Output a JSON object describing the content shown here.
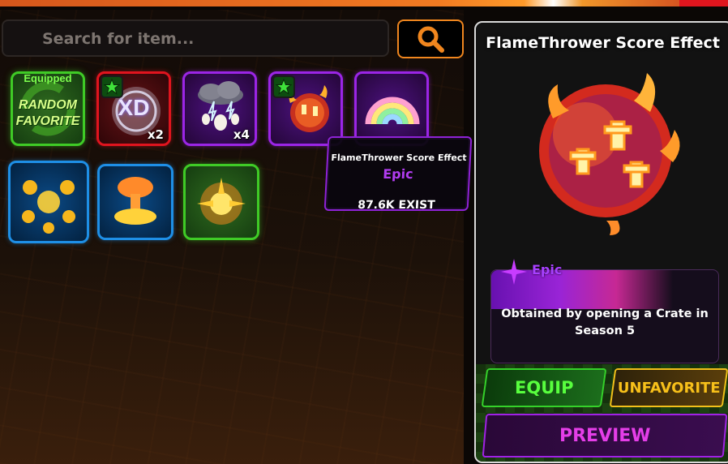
{
  "search": {
    "placeholder": "Search for item..."
  },
  "icons": {
    "search": "search-icon",
    "favorite": "star-icon"
  },
  "inventory": {
    "items": [
      {
        "kind": "random-favorite",
        "line1": "Equipped",
        "line2": "RANDOM",
        "line3": "FAVORITE",
        "border": "green"
      },
      {
        "kind": "xd-effect",
        "label": "XD",
        "quantity": "x2",
        "favorited": true,
        "border": "red"
      },
      {
        "kind": "storm-eggs",
        "quantity": "x4",
        "border": "purple"
      },
      {
        "kind": "flamethrower-score-effect",
        "favorited": true,
        "border": "purple"
      },
      {
        "kind": "rainbow-effect",
        "border": "purple"
      },
      {
        "kind": "coin-burst",
        "border": "blue"
      },
      {
        "kind": "mushroom-explosion",
        "border": "blue"
      },
      {
        "kind": "fire-burst",
        "border": "green"
      }
    ]
  },
  "tooltip": {
    "name": "FlameThrower Score Effect",
    "rarity": "Epic",
    "count": "87.6K EXIST"
  },
  "detail": {
    "title": "FlameThrower Score Effect",
    "rarity": "Epic",
    "description": "Obtained by opening a Crate in Season 5"
  },
  "buttons": {
    "equip": "EQUIP",
    "unfavorite": "UNFAVORITE",
    "preview": "PREVIEW"
  },
  "colors": {
    "accent_orange": "#f0861e",
    "equip_green": "#58ff3e",
    "unfavorite_yellow": "#f7c01a",
    "preview_magenta": "#e53ee8",
    "epic_purple": "#a840ff"
  }
}
